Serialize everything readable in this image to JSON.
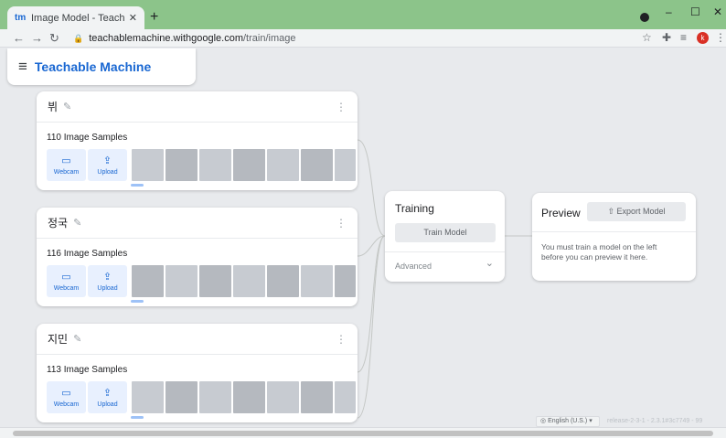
{
  "browser": {
    "tab_title": "Image Model - Teachable Machi",
    "tab_favicon": "tm",
    "new_tab_label": "+",
    "url_host": "teachablemachine.withgoogle.com",
    "url_path": "/train/image",
    "avatar_letter": "k"
  },
  "app": {
    "brand": "Teachable Machine"
  },
  "classes": [
    {
      "name": "뷔",
      "count_label": "110 Image Samples"
    },
    {
      "name": "정국",
      "count_label": "116 Image Samples"
    },
    {
      "name": "지민",
      "count_label": "113 Image Samples"
    }
  ],
  "sources": {
    "webcam_label": "Webcam",
    "upload_label": "Upload"
  },
  "training": {
    "title": "Training",
    "train_button": "Train Model",
    "advanced_label": "Advanced"
  },
  "preview": {
    "title": "Preview",
    "export_button": "Export Model",
    "message": "You must train a model on the left before you can preview it here."
  },
  "footer": {
    "language": "English (U.S.)",
    "release": "release-2-3-1 - 2.3.1#3c7749 - 99"
  },
  "colors": {
    "brand_blue": "#1967d2",
    "tab_strip": "#8cc48a",
    "source_button_bg": "#e8f0fe"
  }
}
